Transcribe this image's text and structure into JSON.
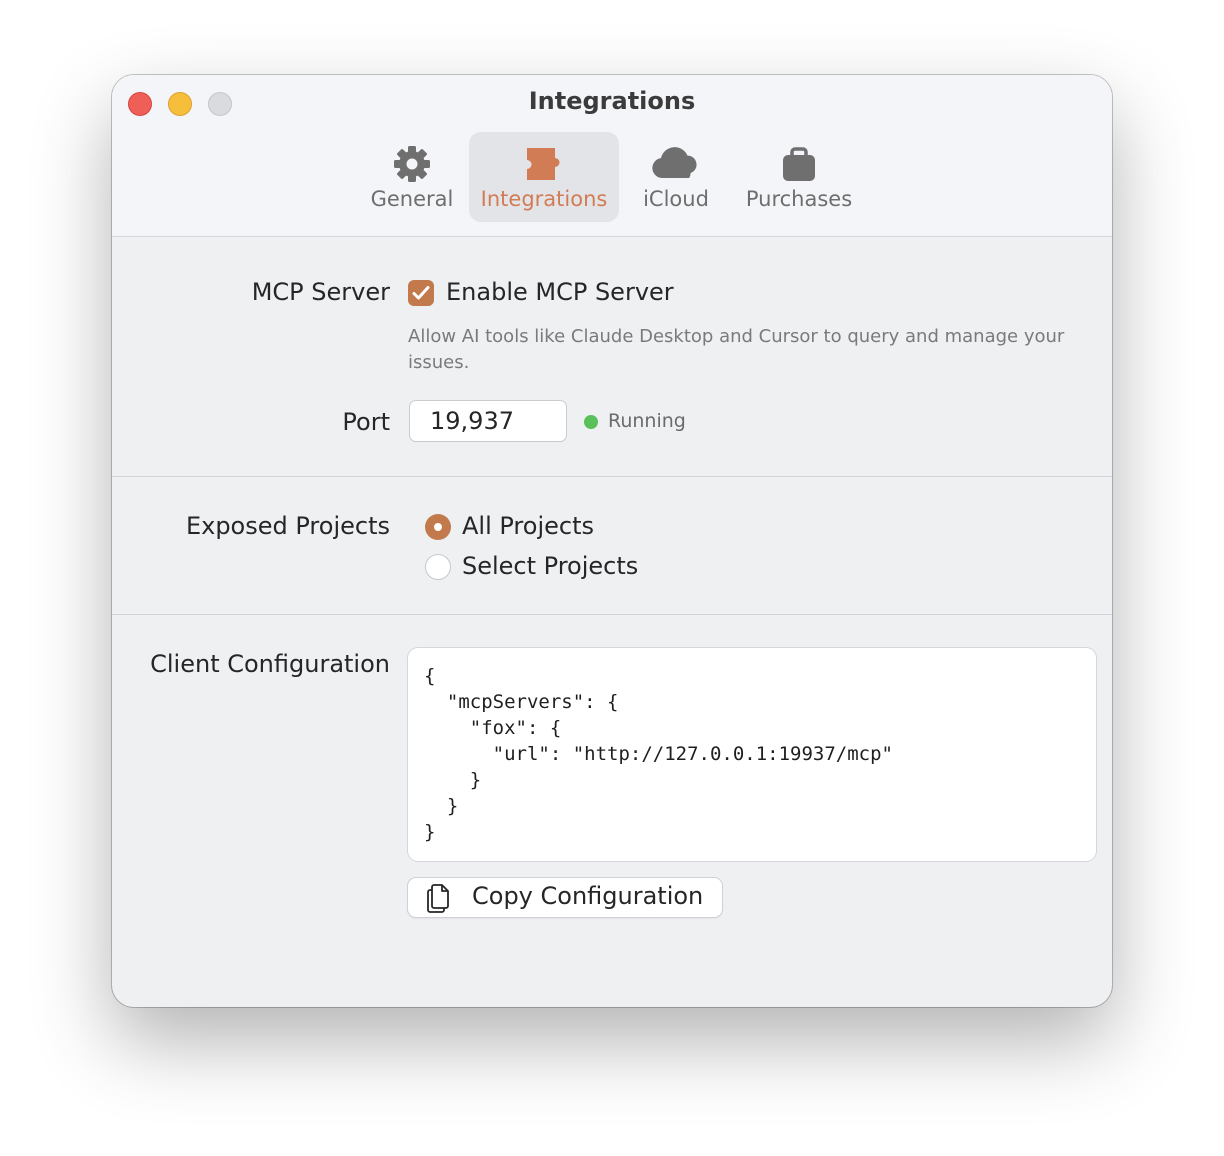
{
  "window": {
    "title": "Integrations"
  },
  "tabs": [
    {
      "label": "General",
      "icon": "gear-icon"
    },
    {
      "label": "Integrations",
      "icon": "puzzle-icon",
      "selected": true
    },
    {
      "label": "iCloud",
      "icon": "cloud-icon"
    },
    {
      "label": "Purchases",
      "icon": "bag-icon"
    }
  ],
  "mcp": {
    "section_label": "MCP Server",
    "enable_label": "Enable MCP Server",
    "enabled": true,
    "help": "Allow AI tools like Claude Desktop and Cursor to query and manage your issues.",
    "port_label": "Port",
    "port_value": "19,937",
    "status": "Running"
  },
  "projects": {
    "section_label": "Exposed Projects",
    "options": [
      {
        "label": "All Projects",
        "selected": true
      },
      {
        "label": "Select Projects",
        "selected": false
      }
    ]
  },
  "client_config": {
    "section_label": "Client Configuration",
    "code_lines": [
      "{",
      "  \"mcpServers\": {",
      "    \"fox\": {",
      "      \"url\": \"http://127.0.0.1:19937/mcp\"",
      "    }",
      "  }",
      "}"
    ],
    "copy_label": "Copy Configuration"
  },
  "colors": {
    "accent": "#c27a4c",
    "accent_text": "#d27c55",
    "status_green": "#5ac05a"
  }
}
